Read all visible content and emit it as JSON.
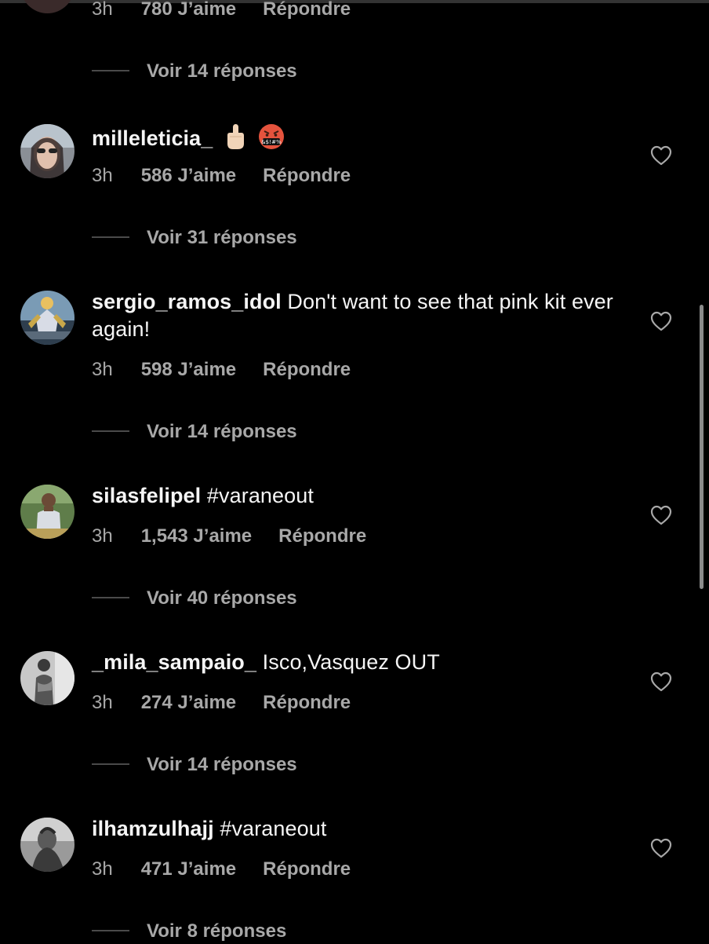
{
  "colors": {
    "background": "#000000",
    "text": "#f5f5f5",
    "secondary": "#a8a8a8"
  },
  "partial_top": {
    "time": "3h",
    "likes": "780 J’aime",
    "reply": "Répondre",
    "view_replies": "Voir 14 réponses"
  },
  "comments": [
    {
      "username": "milleleticia_",
      "text": "",
      "emojis": [
        "middle-finger-emoji",
        "cursing-face-emoji"
      ],
      "time": "3h",
      "likes": "586 J’aime",
      "reply": "Répondre",
      "view_replies": "Voir 31 réponses"
    },
    {
      "username": "sergio_ramos_idol",
      "text": "Don't want to see that pink kit ever again!",
      "time": "3h",
      "likes": "598 J’aime",
      "reply": "Répondre",
      "view_replies": "Voir 14 réponses"
    },
    {
      "username": "silasfelipel",
      "text": "#varaneout",
      "time": "3h",
      "likes": "1,543 J’aime",
      "reply": "Répondre",
      "view_replies": "Voir 40 réponses"
    },
    {
      "username": "_mila_sampaio_",
      "text": "Isco,Vasquez OUT",
      "time": "3h",
      "likes": "274 J’aime",
      "reply": "Répondre",
      "view_replies": "Voir 14 réponses"
    },
    {
      "username": "ilhamzulhajj",
      "text": "#varaneout",
      "time": "3h",
      "likes": "471 J’aime",
      "reply": "Répondre",
      "view_replies": "Voir 8 réponses"
    }
  ]
}
